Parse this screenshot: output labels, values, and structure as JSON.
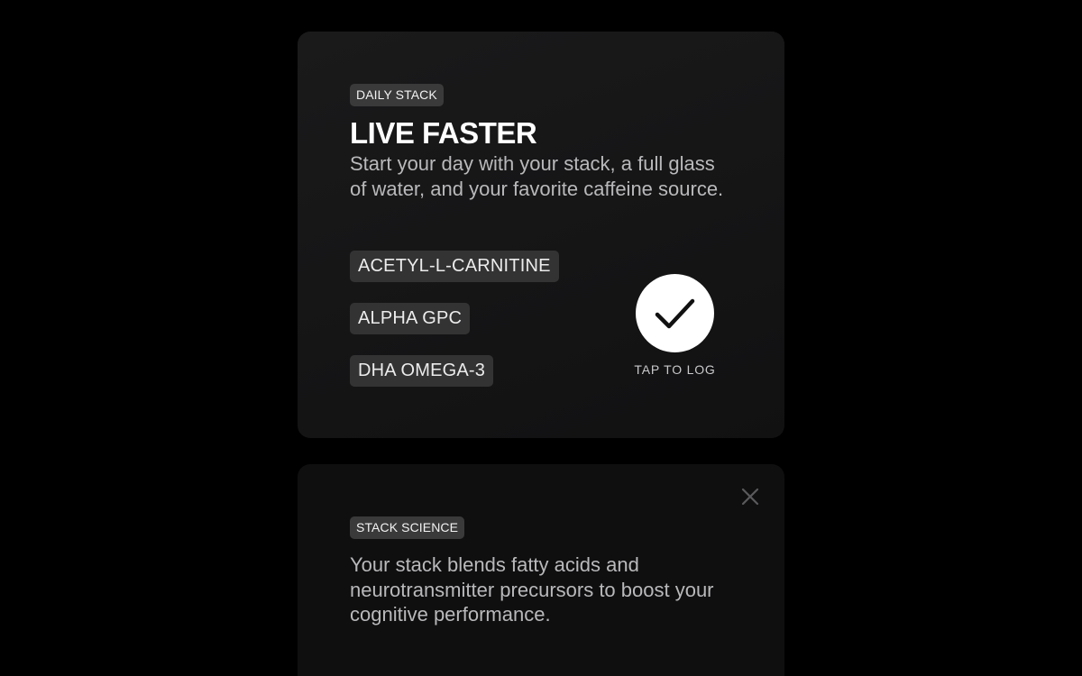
{
  "daily_card": {
    "tag": "DAILY STACK",
    "title": "LIVE FASTER",
    "description": "Start your day with your stack, a full glass of water, and your favorite caffeine source.",
    "ingredients": [
      {
        "label": "ACETYL-L-CARNITINE"
      },
      {
        "label": "ALPHA GPC"
      },
      {
        "label": "DHA OMEGA-3"
      }
    ],
    "log_button_icon": "check-icon",
    "log_caption": "TAP TO LOG"
  },
  "science_card": {
    "tag": "STACK SCIENCE",
    "text": "Your stack blends fatty acids and neurotransmitter precursors to boost your cognitive performance.",
    "close_icon": "close-icon"
  },
  "colors": {
    "background": "#000000",
    "card": "#161617",
    "pill": "#3a3a3b",
    "button": "#ffffff"
  }
}
